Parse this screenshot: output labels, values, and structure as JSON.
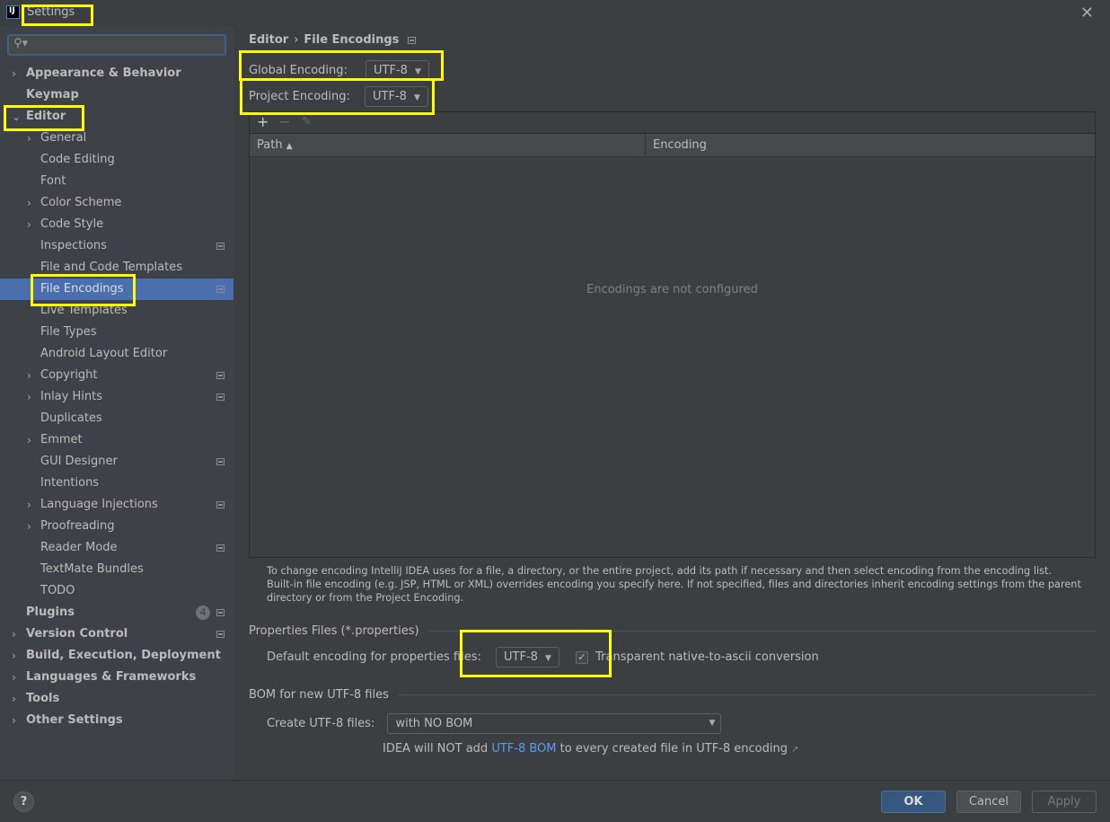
{
  "window": {
    "title": "Settings",
    "close_icon": "close-icon"
  },
  "search": {
    "placeholder": ""
  },
  "sidebar": {
    "items": [
      {
        "label": "Appearance & Behavior",
        "level": 0,
        "arrow": "right"
      },
      {
        "label": "Keymap",
        "level": 0,
        "arrow": ""
      },
      {
        "label": "Editor",
        "level": 0,
        "arrow": "down"
      },
      {
        "label": "General",
        "level": 1,
        "arrow": "right"
      },
      {
        "label": "Code Editing",
        "level": 1,
        "arrow": ""
      },
      {
        "label": "Font",
        "level": 1,
        "arrow": ""
      },
      {
        "label": "Color Scheme",
        "level": 1,
        "arrow": "right"
      },
      {
        "label": "Code Style",
        "level": 1,
        "arrow": "right"
      },
      {
        "label": "Inspections",
        "level": 1,
        "arrow": "",
        "project": true
      },
      {
        "label": "File and Code Templates",
        "level": 1,
        "arrow": ""
      },
      {
        "label": "File Encodings",
        "level": 1,
        "arrow": "",
        "project": true,
        "selected": true
      },
      {
        "label": "Live Templates",
        "level": 1,
        "arrow": ""
      },
      {
        "label": "File Types",
        "level": 1,
        "arrow": ""
      },
      {
        "label": "Android Layout Editor",
        "level": 1,
        "arrow": ""
      },
      {
        "label": "Copyright",
        "level": 1,
        "arrow": "right",
        "project": true
      },
      {
        "label": "Inlay Hints",
        "level": 1,
        "arrow": "right",
        "project": true
      },
      {
        "label": "Duplicates",
        "level": 1,
        "arrow": ""
      },
      {
        "label": "Emmet",
        "level": 1,
        "arrow": "right"
      },
      {
        "label": "GUI Designer",
        "level": 1,
        "arrow": "",
        "project": true
      },
      {
        "label": "Intentions",
        "level": 1,
        "arrow": ""
      },
      {
        "label": "Language Injections",
        "level": 1,
        "arrow": "right",
        "project": true
      },
      {
        "label": "Proofreading",
        "level": 1,
        "arrow": "right"
      },
      {
        "label": "Reader Mode",
        "level": 1,
        "arrow": "",
        "project": true
      },
      {
        "label": "TextMate Bundles",
        "level": 1,
        "arrow": ""
      },
      {
        "label": "TODO",
        "level": 1,
        "arrow": ""
      },
      {
        "label": "Plugins",
        "level": 0,
        "arrow": "",
        "badge": "4",
        "project": true
      },
      {
        "label": "Version Control",
        "level": 0,
        "arrow": "right",
        "project": true
      },
      {
        "label": "Build, Execution, Deployment",
        "level": 0,
        "arrow": "right"
      },
      {
        "label": "Languages & Frameworks",
        "level": 0,
        "arrow": "right"
      },
      {
        "label": "Tools",
        "level": 0,
        "arrow": "right"
      },
      {
        "label": "Other Settings",
        "level": 0,
        "arrow": "right"
      }
    ]
  },
  "main": {
    "breadcrumb": [
      "Editor",
      "File Encodings"
    ],
    "global_label": "Global Encoding:",
    "global_value": "UTF-8",
    "project_label": "Project Encoding:",
    "project_value": "UTF-8",
    "table": {
      "columns": [
        "Path",
        "Encoding"
      ],
      "sort": "ascending",
      "empty_text": "Encodings are not configured"
    },
    "help_lines": [
      "To change encoding IntelliJ IDEA uses for a file, a directory, or the entire project, add its path if necessary and then select encoding from the encoding list.",
      "Built-in file encoding (e.g. JSP, HTML or XML) overrides encoding you specify here. If not specified, files and directories inherit encoding settings from the parent",
      "directory or from the Project Encoding."
    ],
    "properties": {
      "title": "Properties Files (*.properties)",
      "label": "Default encoding for properties files:",
      "value": "UTF-8",
      "checkbox_label": "Transparent native-to-ascii conversion",
      "checked": true
    },
    "bom": {
      "title": "BOM for new UTF-8 files",
      "label": "Create UTF-8 files:",
      "value": "with NO BOM",
      "note_pre": "IDEA will NOT add",
      "note_link": "UTF-8 BOM",
      "note_post": "to every created file in UTF-8 encoding"
    }
  },
  "buttons": {
    "ok": "OK",
    "cancel": "Cancel",
    "apply": "Apply",
    "help": "?"
  },
  "colors": {
    "accent": "#4b6eaf",
    "highlight": "#ffff00",
    "link": "#589df6"
  }
}
